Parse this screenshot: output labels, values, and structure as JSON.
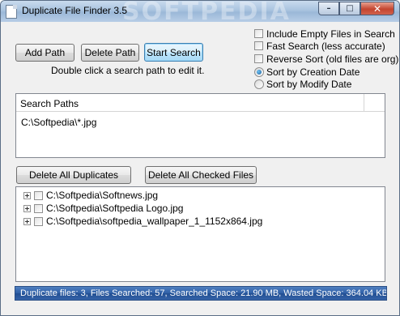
{
  "window": {
    "title": "Duplicate File Finder 3.5",
    "watermark": "SOFTPEDIA",
    "minimize_glyph": "–",
    "maximize_glyph": "□",
    "close_glyph": "✕"
  },
  "toolbar": {
    "add_path_label": "Add Path",
    "delete_path_label": "Delete Path",
    "start_search_label": "Start Search",
    "hint": "Double click a search path to edit it."
  },
  "options": {
    "include_empty": {
      "label": "Include Empty Files in Search",
      "checked": false
    },
    "fast_search": {
      "label": "Fast Search (less accurate)",
      "checked": false
    },
    "reverse_sort": {
      "label": "Reverse Sort (old files are org)",
      "checked": false
    },
    "sort_creation": {
      "label": "Sort by Creation Date",
      "selected": true
    },
    "sort_modify": {
      "label": "Sort by Modify Date",
      "selected": false
    }
  },
  "search_paths": {
    "header": "Search Paths",
    "items": [
      "C:\\Softpedia\\*.jpg"
    ]
  },
  "actions": {
    "delete_all_label": "Delete All Duplicates",
    "delete_checked_label": "Delete All Checked Files"
  },
  "results": {
    "items": [
      {
        "path": "C:\\Softpedia\\Softnews.jpg",
        "checked": false
      },
      {
        "path": "C:\\Softpedia\\Softpedia Logo.jpg",
        "checked": false
      },
      {
        "path": "C:\\Softpedia\\softpedia_wallpaper_1_1152x864.jpg",
        "checked": false
      }
    ]
  },
  "status": {
    "text": "Duplicate files: 3, Files Searched: 57, Searched Space: 21.90 MB, Wasted Space: 364.04 KB"
  },
  "colors": {
    "status_bar": "#2f5fa6",
    "window_bg": "#f0f0f0",
    "title_bar": "#a9c3df"
  }
}
